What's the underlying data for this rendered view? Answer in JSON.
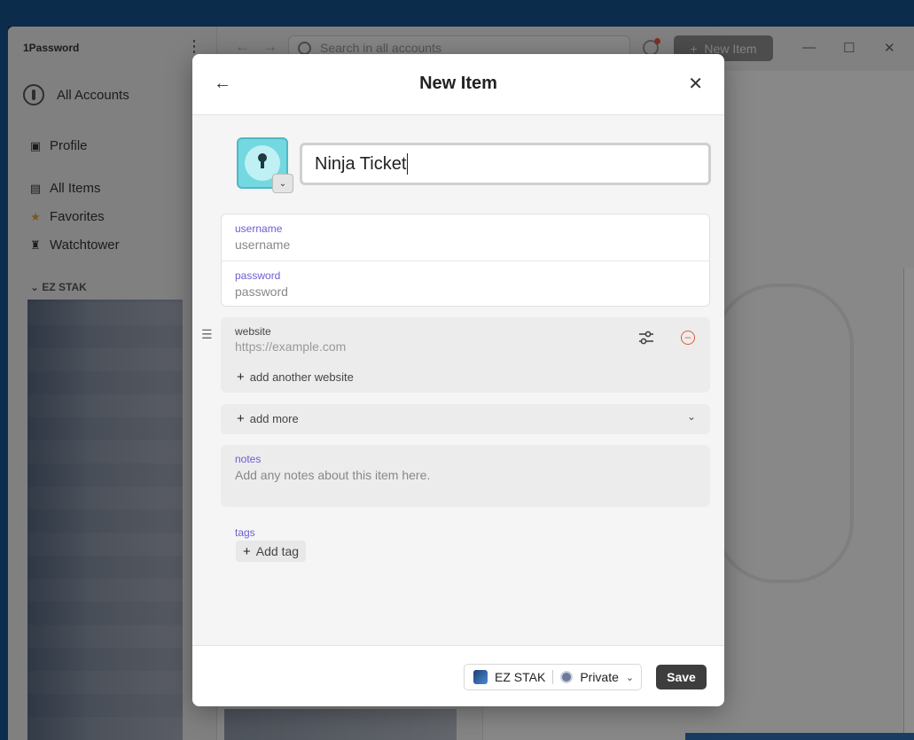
{
  "app": {
    "brand": "1Password",
    "accounts_label": "All Accounts",
    "sidebar": {
      "profile": "Profile",
      "all_items": "All Items",
      "favorites": "Favorites",
      "watchtower": "Watchtower",
      "section": "EZ STAK"
    },
    "search": {
      "placeholder": "Search in all accounts"
    },
    "new_item_button": "New Item"
  },
  "modal": {
    "title": "New Item",
    "item_title": "Ninja Ticket",
    "fields": {
      "username": {
        "label": "username",
        "placeholder": "username"
      },
      "password": {
        "label": "password",
        "placeholder": "password"
      },
      "website": {
        "label": "website",
        "placeholder": "https://example.com"
      }
    },
    "add_website": "add another website",
    "add_more": "add more",
    "notes": {
      "label": "notes",
      "placeholder": "Add any notes about this item here."
    },
    "tags": {
      "label": "tags",
      "add_label": "Add tag"
    },
    "footer": {
      "account": "EZ STAK",
      "vault": "Private",
      "save": "Save"
    }
  },
  "colors": {
    "accent_label": "#6b5fd0",
    "remove_icon": "#e05a3a",
    "item_icon": "#74d8e1",
    "save_button": "#3d3d3d"
  },
  "icons": [
    "back-arrow-icon",
    "close-icon",
    "keyhole-icon",
    "chevron-down-icon",
    "drag-handle-icon",
    "settings-sliders-icon",
    "remove-circle-icon",
    "plus-icon",
    "vault-icon"
  ]
}
